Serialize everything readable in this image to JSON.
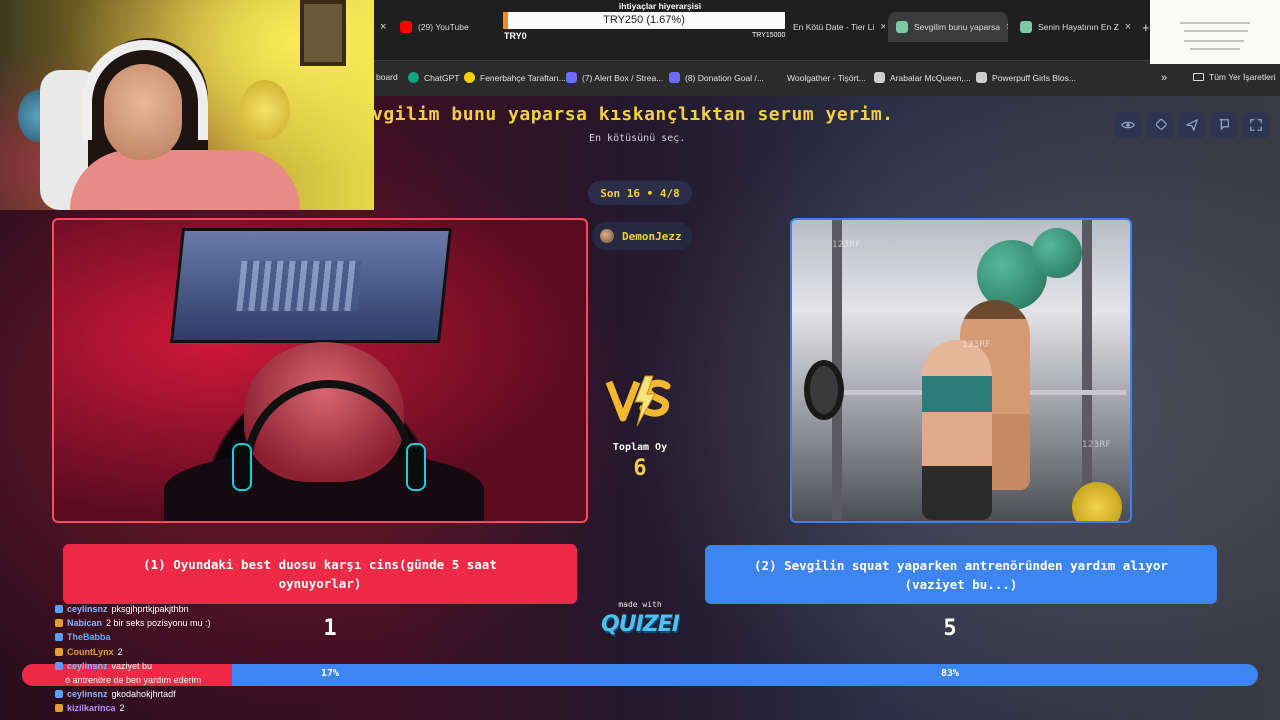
{
  "browser": {
    "tabs": [
      {
        "label": "(29) YouTube",
        "icon": "youtube-icon",
        "color": "#ff0000",
        "active": false
      },
      {
        "label": "En Kötü Date - Tier Li",
        "icon": "page-icon",
        "color": "#888888",
        "active": false
      },
      {
        "label": "Sevgilim bunu yaparsa",
        "icon": "quizei-tab-icon",
        "color": "#7bc8a4",
        "active": true
      },
      {
        "label": "Senin Hayatının En Z",
        "icon": "quizei-tab-icon",
        "color": "#7bc8a4",
        "active": false
      }
    ],
    "new_tab_label": "+",
    "bookmarks": [
      {
        "label": "board",
        "icon": "page-icon",
        "color": "#888888"
      },
      {
        "label": "ChatGPT",
        "icon": "chatgpt-icon",
        "color": "#10a37f"
      },
      {
        "label": "Fenerbahçe Taraftarı...",
        "icon": "fenerbahce-icon",
        "color": "#f5d000"
      },
      {
        "label": "(7) Alert Box / Strea...",
        "icon": "streamelements-icon",
        "color": "#6b6bff"
      },
      {
        "label": "(8) Donation Goal /...",
        "icon": "streamelements-icon",
        "color": "#6b6bff"
      },
      {
        "label": "Woolgather - Tişört...",
        "icon": "woolgather-icon",
        "color": "#2b2b2b"
      },
      {
        "label": "Arabalar McQueen,...",
        "icon": "page-icon",
        "color": "#cfcfcf"
      },
      {
        "label": "Powerpuff Girls Blos...",
        "icon": "page-icon",
        "color": "#cfcfcf"
      }
    ],
    "bookmarks_more": "»",
    "all_bookmarks": "Tüm Yer İşaretleri"
  },
  "donation_goal": {
    "title": "ihtiyaçlar hiyerarşisi",
    "label": "TRY250 (1.67%)",
    "progress": 0.0167,
    "min": "TRY0",
    "max": "TRY15000",
    "color": "#f18a27"
  },
  "quiz": {
    "title": "vgilim bunu yaparsa kıskançlıktan serum yerim.",
    "subtitle": "En kötüsünü seç.",
    "round": "Son 16 • 4/8",
    "author": "DemonJezz",
    "controls": [
      "eye-icon",
      "copy-icon",
      "send-icon",
      "flag-icon",
      "fullscreen-icon"
    ],
    "vs_label": "VS",
    "total_label": "Toplam Oy",
    "total_votes": "6",
    "option_left": {
      "text": "(1) Oyundaki best duosu karşı cins(günde 5 saat oynuyorlar)",
      "votes": "1",
      "percent": "17%",
      "color": "#ee2a46"
    },
    "option_right": {
      "text": "(2) Sevgilin squat yaparken antrenöründen yardım alıyor (vaziyet bu...)",
      "votes": "5",
      "percent": "83%",
      "color": "#3d85f3"
    },
    "split": 0.17,
    "made_with": "made with",
    "brand": "QUIZEI",
    "watermark": "123RF"
  },
  "chat": [
    {
      "user": "ceylinsnz",
      "msg": "pksgjhprtkjpakjthbn",
      "color": "#8fb4ff"
    },
    {
      "user": "Nabican",
      "msg": "2 bir seks pozisyonu mu :)",
      "color": "#8fb4ff"
    },
    {
      "user": "TheBabba",
      "msg": "",
      "color": "#5ab0ff"
    },
    {
      "user": "CountLynx",
      "msg": "2",
      "color": "#e0a030"
    },
    {
      "user": "ceylinsnz",
      "msg": "vaziyet bu",
      "color": "#8fb4ff"
    },
    {
      "user": "",
      "msg": "o antrenöre de ben yardım ederim",
      "color": "#ff3b3b"
    },
    {
      "user": "ceylinsnz",
      "msg": "gkodahokjhrtadf",
      "color": "#8fb4ff"
    },
    {
      "user": "kizilkarinca",
      "msg": "2",
      "color": "#b48aff"
    }
  ]
}
